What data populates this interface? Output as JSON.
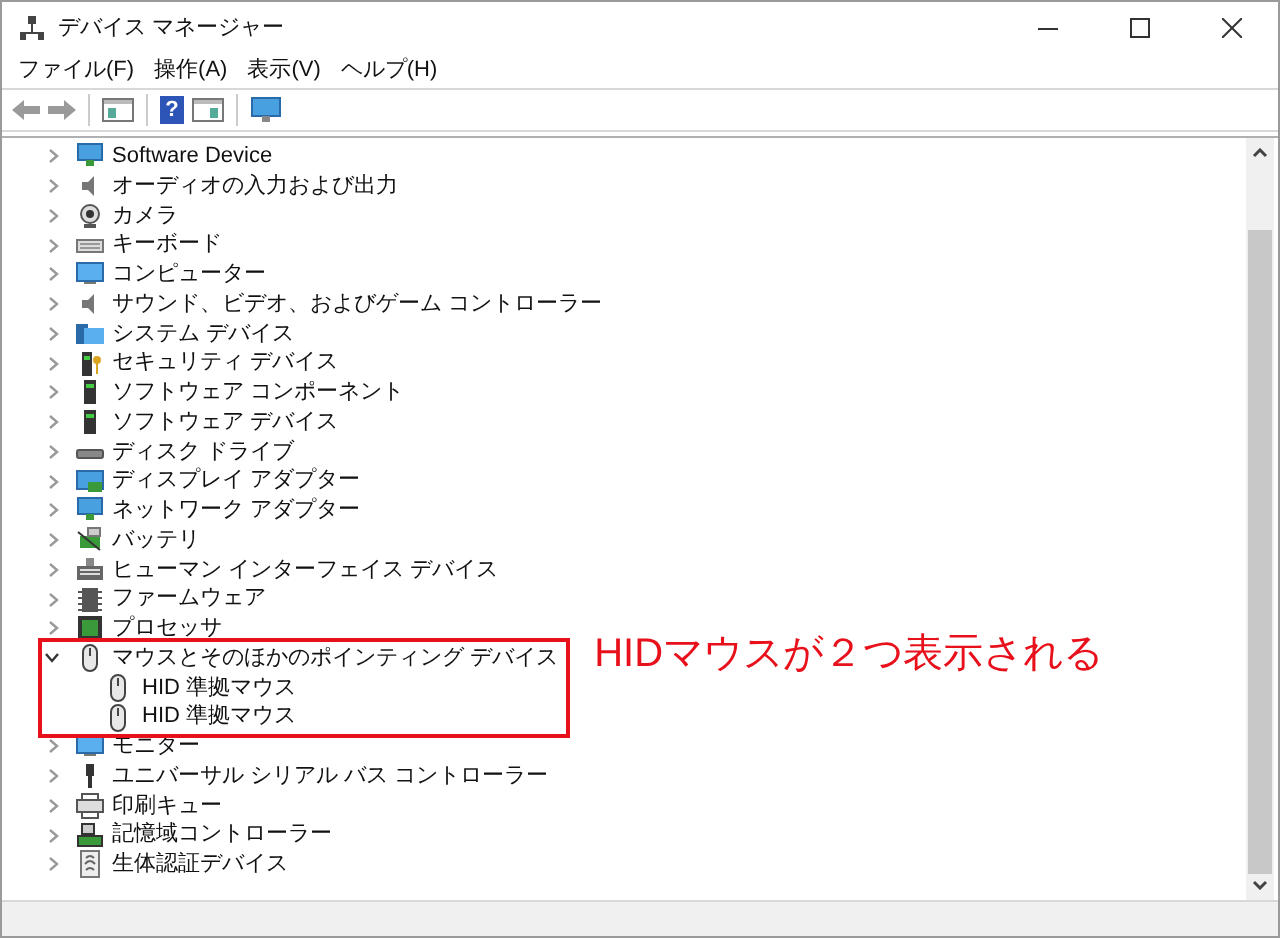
{
  "window": {
    "title": "デバイス マネージャー"
  },
  "toolbar": {
    "help_label": "?"
  },
  "menu": [
    "ファイル(F)",
    "操作(A)",
    "表示(V)",
    "ヘルプ(H)"
  ],
  "tree": [
    {
      "label": "Software Device",
      "expanded": false
    },
    {
      "label": "オーディオの入力および出力",
      "expanded": false
    },
    {
      "label": "カメラ",
      "expanded": false
    },
    {
      "label": "キーボード",
      "expanded": false
    },
    {
      "label": "コンピューター",
      "expanded": false
    },
    {
      "label": "サウンド、ビデオ、およびゲーム コントローラー",
      "expanded": false
    },
    {
      "label": "システム デバイス",
      "expanded": false
    },
    {
      "label": "セキュリティ デバイス",
      "expanded": false
    },
    {
      "label": "ソフトウェア コンポーネント",
      "expanded": false
    },
    {
      "label": "ソフトウェア デバイス",
      "expanded": false
    },
    {
      "label": "ディスク ドライブ",
      "expanded": false
    },
    {
      "label": "ディスプレイ アダプター",
      "expanded": false
    },
    {
      "label": "ネットワーク アダプター",
      "expanded": false
    },
    {
      "label": "バッテリ",
      "expanded": false
    },
    {
      "label": "ヒューマン インターフェイス デバイス",
      "expanded": false
    },
    {
      "label": "ファームウェア",
      "expanded": false
    },
    {
      "label": "プロセッサ",
      "expanded": false
    },
    {
      "label": "マウスとそのほかのポインティング デバイス",
      "expanded": true,
      "children": [
        {
          "label": "HID 準拠マウス"
        },
        {
          "label": "HID 準拠マウス"
        }
      ]
    },
    {
      "label": "モニター",
      "expanded": false
    },
    {
      "label": "ユニバーサル シリアル バス コントローラー",
      "expanded": false
    },
    {
      "label": "印刷キュー",
      "expanded": false
    },
    {
      "label": "記憶域コントローラー",
      "expanded": false
    },
    {
      "label": "生体認証デバイス",
      "expanded": false
    }
  ],
  "annotation": {
    "text": "HIDマウスが２つ表示される"
  }
}
